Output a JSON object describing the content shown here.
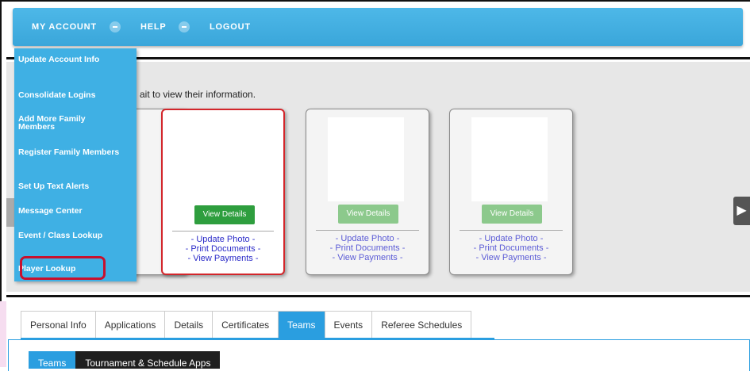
{
  "nav": {
    "items": [
      {
        "label": "MY ACCOUNT"
      },
      {
        "label": "HELP"
      },
      {
        "label": "LOGOUT"
      }
    ]
  },
  "instruction": "ait to view their information.",
  "dropdown": {
    "items": [
      {
        "label": "Update Account Info"
      },
      {
        "label": "Consolidate Logins"
      },
      {
        "label": "Add More Family Members"
      },
      {
        "label": "Register Family Members"
      },
      {
        "label": "Set Up Text Alerts"
      },
      {
        "label": "Message Center"
      },
      {
        "label": "Event / Class Lookup"
      },
      {
        "label": "Player Lookup"
      }
    ]
  },
  "cards": [
    {
      "button": "View Details",
      "links": [
        "- Update Photo -",
        "- Print Documents -",
        "- View Payments -"
      ],
      "selected": true
    },
    {
      "button": "View Details",
      "links": [
        "- Update Photo -",
        "- Print Documents -",
        "- View Payments -"
      ],
      "selected": false
    },
    {
      "button": "View Details",
      "links": [
        "- Update Photo -",
        "- Print Documents -",
        "- View Payments -"
      ],
      "selected": false
    }
  ],
  "tabs": [
    {
      "label": "Personal Info"
    },
    {
      "label": "Applications"
    },
    {
      "label": "Details"
    },
    {
      "label": "Certificates"
    },
    {
      "label": "Teams",
      "active": true
    },
    {
      "label": "Events"
    },
    {
      "label": "Referee Schedules"
    }
  ],
  "subtabs": [
    {
      "label": "Teams"
    },
    {
      "label": "Tournament & Schedule Apps"
    }
  ],
  "colors": {
    "nav_blue": "#3aa6da",
    "highlight_red": "#c8102e",
    "active_tab": "#2a9ee0",
    "view_button_green": "#2e9e3e"
  }
}
